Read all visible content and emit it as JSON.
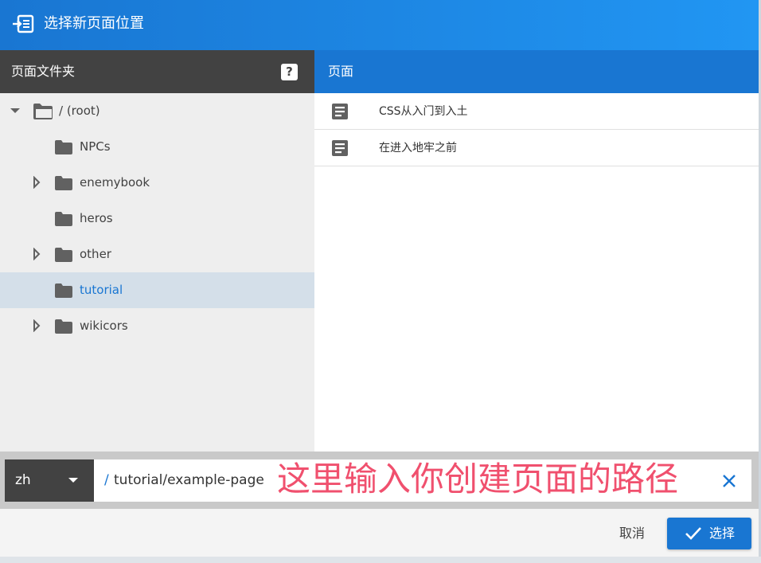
{
  "dialog": {
    "title": "选择新页面位置",
    "title_icon": "page-move-icon"
  },
  "folders_panel": {
    "title": "页面文件夹",
    "help_label": "?",
    "tree": [
      {
        "label": "/ (root)",
        "expanded": true,
        "has_children": true
      },
      {
        "label": "NPCs",
        "has_children": false
      },
      {
        "label": "enemybook",
        "has_children": true
      },
      {
        "label": "heros",
        "has_children": false
      },
      {
        "label": "other",
        "has_children": true
      },
      {
        "label": "tutorial",
        "has_children": false,
        "selected": true
      },
      {
        "label": "wikicors",
        "has_children": true
      }
    ]
  },
  "pages_panel": {
    "title": "页面",
    "pages": [
      {
        "label": "CSS从入门到入土"
      },
      {
        "label": "在进入地牢之前"
      }
    ]
  },
  "path_bar": {
    "locale": "zh",
    "slash": "/",
    "path_value": "tutorial/example-page",
    "annotation": "这里输入你创建页面的路径"
  },
  "footer": {
    "cancel_label": "取消",
    "select_label": "选择"
  },
  "colors": {
    "primary": "#1976d2",
    "dark_header": "#424242",
    "annotation": "#f0506e",
    "selected_row": "#d4dfe9"
  }
}
